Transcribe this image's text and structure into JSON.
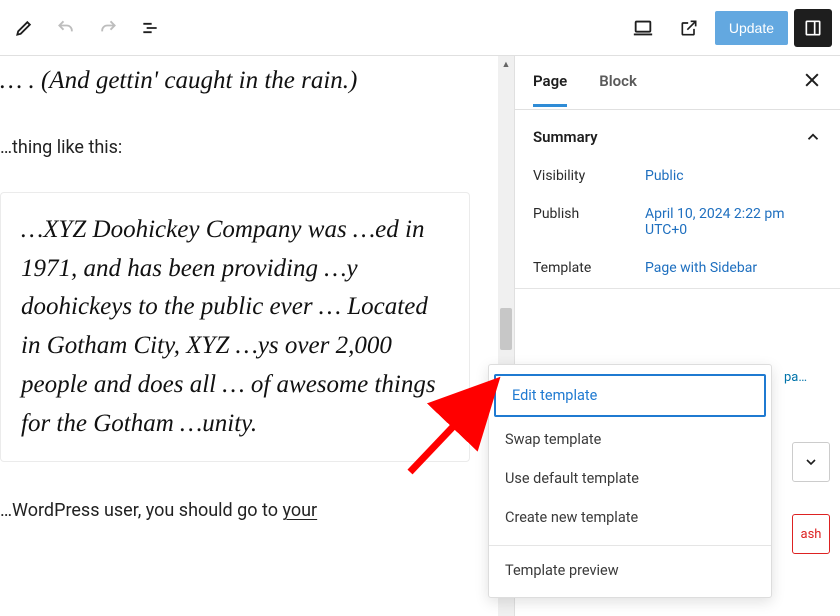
{
  "topbar": {
    "update_label": "Update"
  },
  "editor": {
    "italic1": "… . (And gettin' caught in the rain.)",
    "reg1": "…thing like this:",
    "boxPara": "…XYZ Doohickey Company was …ed in 1971, and has been providing …y doohickeys to the public ever … Located in Gotham City, XYZ …ys over 2,000 people and does all … of awesome things for the Gotham …unity.",
    "reg2_prefix": "…WordPress user, you should go to ",
    "reg2_link": "your"
  },
  "sidebar": {
    "tabs": {
      "page": "Page",
      "block": "Block"
    },
    "summary": {
      "title": "Summary",
      "visibility_label": "Visibility",
      "visibility_value": "Public",
      "publish_label": "Publish",
      "publish_value": "April 10, 2024 2:22 pm UTC+0",
      "template_label": "Template",
      "template_value": "Page with Sidebar"
    },
    "extra_link": "pa…",
    "trash_label": "ash"
  },
  "tmpl_menu": {
    "edit": "Edit template",
    "swap": "Swap template",
    "use_default": "Use default template",
    "create": "Create new template",
    "preview": "Template preview"
  }
}
